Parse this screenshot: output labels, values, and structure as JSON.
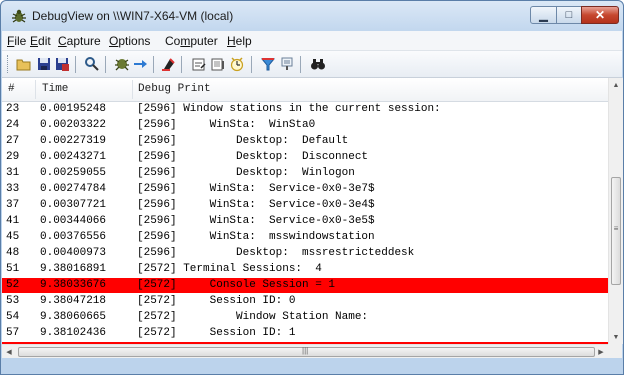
{
  "window": {
    "title": "DebugView on \\\\WIN7-X64-VM (local)",
    "close_color": "#c6472f"
  },
  "menubar": {
    "items": [
      {
        "accel": "F",
        "rest": "ile"
      },
      {
        "accel": "E",
        "rest": "dit"
      },
      {
        "accel": "C",
        "rest": "apture"
      },
      {
        "accel": "O",
        "rest": "ptions"
      },
      {
        "pre": "Co",
        "accel": "m",
        "rest": "puter"
      },
      {
        "accel": "H",
        "rest": "elp"
      }
    ]
  },
  "toolbar": {
    "icons": [
      "open-icon",
      "save-icon",
      "save-multiple-icon",
      "find-icon",
      "capture-icon",
      "forward-icon",
      "clear-icon",
      "time-icon",
      "clock-icon",
      "history-icon",
      "filter-icon",
      "highlight-icon",
      "binoculars-icon"
    ]
  },
  "columns": [
    "#",
    "Time",
    "Debug Print"
  ],
  "rows": [
    {
      "num": "23",
      "time": "0.00195248",
      "print": "[2596] Window stations in the current session:",
      "highlight": false
    },
    {
      "num": "24",
      "time": "0.00203322",
      "print": "[2596]     WinSta:  WinSta0",
      "highlight": false
    },
    {
      "num": "27",
      "time": "0.00227319",
      "print": "[2596]         Desktop:  Default",
      "highlight": false
    },
    {
      "num": "29",
      "time": "0.00243271",
      "print": "[2596]         Desktop:  Disconnect",
      "highlight": false
    },
    {
      "num": "31",
      "time": "0.00259055",
      "print": "[2596]         Desktop:  Winlogon",
      "highlight": false
    },
    {
      "num": "33",
      "time": "0.00274784",
      "print": "[2596]     WinSta:  Service-0x0-3e7$",
      "highlight": false
    },
    {
      "num": "37",
      "time": "0.00307721",
      "print": "[2596]     WinSta:  Service-0x0-3e4$",
      "highlight": false
    },
    {
      "num": "41",
      "time": "0.00344066",
      "print": "[2596]     WinSta:  Service-0x0-3e5$",
      "highlight": false
    },
    {
      "num": "45",
      "time": "0.00376556",
      "print": "[2596]     WinSta:  msswindowstation",
      "highlight": false
    },
    {
      "num": "48",
      "time": "0.00400973",
      "print": "[2596]         Desktop:  mssrestricteddesk",
      "highlight": false
    },
    {
      "num": "51",
      "time": "9.38016891",
      "print": "[2572] Terminal Sessions:  4",
      "highlight": false
    },
    {
      "num": "52",
      "time": "9.38033676",
      "print": "[2572]     Console Session = 1",
      "highlight": true
    },
    {
      "num": "53",
      "time": "9.38047218",
      "print": "[2572]     Session ID: 0",
      "highlight": false
    },
    {
      "num": "54",
      "time": "9.38060665",
      "print": "[2572]         Window Station Name:",
      "highlight": false
    },
    {
      "num": "57",
      "time": "9.38102436",
      "print": "[2572]     Session ID: 1",
      "highlight": false
    }
  ],
  "highlight_color": "#ff0000"
}
